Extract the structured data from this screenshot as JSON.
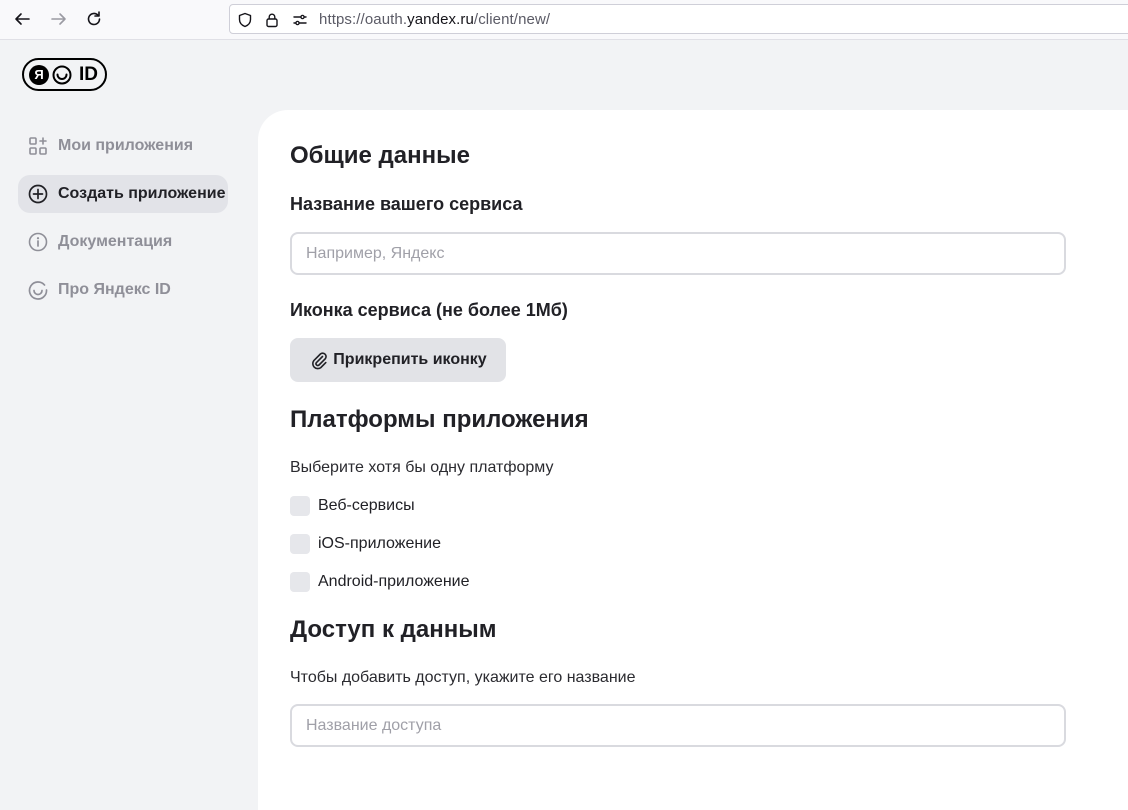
{
  "browser": {
    "url_prefix": "https://oauth.",
    "url_domain": "yandex.ru",
    "url_path": "/client/new/"
  },
  "logo": {
    "mark": "Я",
    "text": "ID"
  },
  "sidebar": {
    "items": [
      {
        "label": "Мои приложения",
        "icon": "apps-add-icon",
        "active": false
      },
      {
        "label": "Создать приложение",
        "icon": "plus-circle-icon",
        "active": true
      },
      {
        "label": "Документация",
        "icon": "info-circle-icon",
        "active": false
      },
      {
        "label": "Про Яндекс ID",
        "icon": "yandex-id-smile-icon",
        "active": false
      }
    ]
  },
  "form": {
    "general_title": "Общие данные",
    "service_name_label": "Название вашего сервиса",
    "service_name_placeholder": "Например, Яндекс",
    "service_name_value": "",
    "icon_label": "Иконка сервиса (не более 1Мб)",
    "attach_button": "Прикрепить иконку",
    "platforms_title": "Платформы приложения",
    "platforms_hint": "Выберите хотя бы одну платформу",
    "platforms": [
      {
        "label": "Веб-сервисы",
        "checked": false
      },
      {
        "label": "iOS-приложение",
        "checked": false
      },
      {
        "label": "Android-приложение",
        "checked": false
      }
    ],
    "access_title": "Доступ к данным",
    "access_hint": "Чтобы добавить доступ, укажите его название",
    "access_placeholder": "Название доступа",
    "access_value": ""
  }
}
